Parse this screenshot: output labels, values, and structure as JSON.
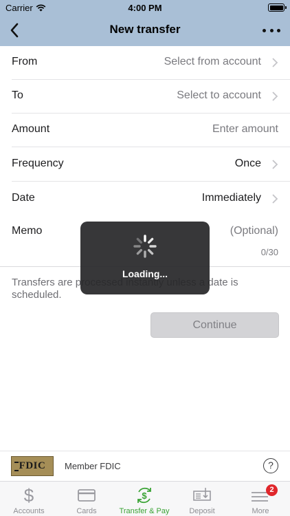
{
  "status_bar": {
    "carrier": "Carrier",
    "time": "4:00 PM"
  },
  "nav": {
    "title": "New transfer"
  },
  "form": {
    "from": {
      "label": "From",
      "value": "Select from account"
    },
    "to": {
      "label": "To",
      "value": "Select to account"
    },
    "amount": {
      "label": "Amount",
      "placeholder": "Enter amount"
    },
    "frequency": {
      "label": "Frequency",
      "value": "Once"
    },
    "date": {
      "label": "Date",
      "value": "Immediately"
    },
    "memo": {
      "label": "Memo",
      "placeholder": "(Optional)",
      "counter": "0/30"
    }
  },
  "note": "Transfers are processed instantly unless a date is scheduled.",
  "continue_label": "Continue",
  "loading": {
    "text": "Loading..."
  },
  "footer": {
    "logo_text": "FDIC",
    "member_text": "Member FDIC",
    "help": "?"
  },
  "tabs": [
    {
      "label": "Accounts",
      "icon": "dollar-icon"
    },
    {
      "label": "Cards",
      "icon": "card-icon"
    },
    {
      "label": "Transfer & Pay",
      "icon": "transfer-pay-icon",
      "active": true
    },
    {
      "label": "Deposit",
      "icon": "check-deposit-icon"
    },
    {
      "label": "More",
      "icon": "menu-icon",
      "badge": "2"
    }
  ],
  "colors": {
    "header": "#a9bfd6",
    "active_tab": "#3aa335",
    "badge": "#e0262b"
  }
}
